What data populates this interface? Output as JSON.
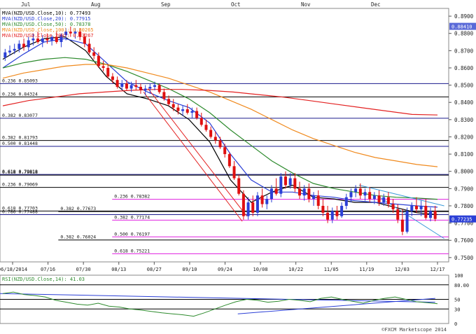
{
  "chart_data": [
    {
      "type": "candlestick",
      "title": "",
      "ylim": [
        0.7475,
        0.8945
      ],
      "months": [
        "Jul",
        "Aug",
        "Sep",
        "Oct",
        "Nov",
        "Dec"
      ],
      "date_ticks": [
        "06/18/2014",
        "07/16",
        "07/30",
        "08/13",
        "08/27",
        "09/10",
        "09/24",
        "10/08",
        "10/22",
        "11/05",
        "11/19",
        "12/03",
        "12/17"
      ],
      "price_ticks": [
        {
          "label": "0.8900",
          "v": 0.89
        },
        {
          "label": "0.8800",
          "v": 0.88
        },
        {
          "label": "0.8700",
          "v": 0.87
        },
        {
          "label": "0.8600",
          "v": 0.86
        },
        {
          "label": "0.8500",
          "v": 0.85
        },
        {
          "label": "0.8400",
          "v": 0.84
        },
        {
          "label": "0.8300",
          "v": 0.83
        },
        {
          "label": "0.8200",
          "v": 0.82
        },
        {
          "label": "0.8100",
          "v": 0.81
        },
        {
          "label": "0.8000",
          "v": 0.8
        },
        {
          "label": "0.7900",
          "v": 0.79
        },
        {
          "label": "0.7800",
          "v": 0.78
        },
        {
          "label": "0.7700",
          "v": 0.77
        },
        {
          "label": "0.7600",
          "v": 0.76
        },
        {
          "label": "0.7500",
          "v": 0.75
        }
      ],
      "legend": [
        {
          "text": "MVA(NZD/USD.Close,10): 0.77493",
          "color": "#000000"
        },
        {
          "text": "MVA(NZD/USD.Close,20): 0.77915",
          "color": "#2b3fd6"
        },
        {
          "text": "MVA(NZD/USD.Close,50): 0.78378",
          "color": "#2e8b2e"
        },
        {
          "text": "MVA(NZD/USD.Close,100): 0.80265",
          "color": "#f08a1e"
        },
        {
          "text": "MVA(NZD/USD.Close,200): 0.83267",
          "color": "#e32222"
        }
      ],
      "price_badges": [
        {
          "label": "0.88410",
          "v": 0.8841,
          "color": "#5a6ad8"
        },
        {
          "label": "0.77235",
          "v": 0.7724,
          "color": "#2b3fd6"
        }
      ],
      "fib_levels": [
        {
          "label": "0.236 0.85093",
          "v": 0.8509,
          "color": "#1a1a8c",
          "x_start": 0.0
        },
        {
          "label": "0.236 0.84324",
          "v": 0.8432,
          "color": "#000000",
          "x_start": 0.0
        },
        {
          "label": "0.382 0.83077",
          "v": 0.8308,
          "color": "#1a1a8c",
          "x_start": 0.0
        },
        {
          "label": "0.382 0.81793",
          "v": 0.8179,
          "color": "#000000",
          "x_start": 0.0
        },
        {
          "label": "0.500 0.81448",
          "v": 0.8145,
          "color": "#1a1a8c",
          "x_start": 0.0
        },
        {
          "label": "0.618 0.79818",
          "v": 0.7982,
          "color": "#1a1a8c",
          "x_start": 0.0
        },
        {
          "label": "0.618 0.79818",
          "v": 0.7978,
          "color": "#000000",
          "x_start": 0.0
        },
        {
          "label": "0.236 0.79069",
          "v": 0.7907,
          "color": "#000000",
          "x_start": 0.0
        },
        {
          "label": "0.236 0.78382",
          "v": 0.7838,
          "color": "#e020e0",
          "x_start": 0.25
        },
        {
          "label": "0.618 0.77703",
          "v": 0.777,
          "color": "#000000",
          "x_start": 0.0
        },
        {
          "label": "0.382 0.77673",
          "v": 0.7767,
          "color": "#000000",
          "x_start": 0.13
        },
        {
          "label": "0.786 0.77488",
          "v": 0.7749,
          "color": "#1a1a8c",
          "x_start": 0.0
        },
        {
          "label": "0.382 0.77174",
          "v": 0.7717,
          "color": "#e020e0",
          "x_start": 0.25
        },
        {
          "label": "0.500 0.76197",
          "v": 0.762,
          "color": "#e020e0",
          "x_start": 0.25
        },
        {
          "label": "0.382 0.76024",
          "v": 0.7602,
          "color": "#000000",
          "x_start": 0.13
        },
        {
          "label": "0.618 0.75221",
          "v": 0.7522,
          "color": "#e020e0",
          "x_start": 0.25
        }
      ],
      "candles": [
        {
          "o": 0.866,
          "h": 0.871,
          "l": 0.864,
          "c": 0.869
        },
        {
          "o": 0.869,
          "h": 0.873,
          "l": 0.867,
          "c": 0.87
        },
        {
          "o": 0.87,
          "h": 0.874,
          "l": 0.868,
          "c": 0.871
        },
        {
          "o": 0.871,
          "h": 0.876,
          "l": 0.869,
          "c": 0.874
        },
        {
          "o": 0.874,
          "h": 0.877,
          "l": 0.87,
          "c": 0.872
        },
        {
          "o": 0.872,
          "h": 0.878,
          "l": 0.87,
          "c": 0.876
        },
        {
          "o": 0.876,
          "h": 0.88,
          "l": 0.873,
          "c": 0.877
        },
        {
          "o": 0.877,
          "h": 0.881,
          "l": 0.874,
          "c": 0.875
        },
        {
          "o": 0.875,
          "h": 0.879,
          "l": 0.872,
          "c": 0.877
        },
        {
          "o": 0.877,
          "h": 0.88,
          "l": 0.874,
          "c": 0.876
        },
        {
          "o": 0.876,
          "h": 0.879,
          "l": 0.873,
          "c": 0.878
        },
        {
          "o": 0.878,
          "h": 0.881,
          "l": 0.874,
          "c": 0.875
        },
        {
          "o": 0.875,
          "h": 0.88,
          "l": 0.872,
          "c": 0.879
        },
        {
          "o": 0.879,
          "h": 0.883,
          "l": 0.876,
          "c": 0.881
        },
        {
          "o": 0.881,
          "h": 0.884,
          "l": 0.878,
          "c": 0.88
        },
        {
          "o": 0.88,
          "h": 0.883,
          "l": 0.877,
          "c": 0.881
        },
        {
          "o": 0.881,
          "h": 0.883,
          "l": 0.876,
          "c": 0.878
        },
        {
          "o": 0.878,
          "h": 0.88,
          "l": 0.872,
          "c": 0.874
        },
        {
          "o": 0.874,
          "h": 0.877,
          "l": 0.868,
          "c": 0.869
        },
        {
          "o": 0.869,
          "h": 0.872,
          "l": 0.865,
          "c": 0.867
        },
        {
          "o": 0.867,
          "h": 0.869,
          "l": 0.86,
          "c": 0.861
        },
        {
          "o": 0.861,
          "h": 0.864,
          "l": 0.858,
          "c": 0.86
        },
        {
          "o": 0.86,
          "h": 0.862,
          "l": 0.854,
          "c": 0.855
        },
        {
          "o": 0.855,
          "h": 0.857,
          "l": 0.851,
          "c": 0.853
        },
        {
          "o": 0.853,
          "h": 0.855,
          "l": 0.848,
          "c": 0.849
        },
        {
          "o": 0.849,
          "h": 0.853,
          "l": 0.847,
          "c": 0.851
        },
        {
          "o": 0.851,
          "h": 0.853,
          "l": 0.847,
          "c": 0.848
        },
        {
          "o": 0.848,
          "h": 0.852,
          "l": 0.846,
          "c": 0.85
        },
        {
          "o": 0.85,
          "h": 0.853,
          "l": 0.847,
          "c": 0.849
        },
        {
          "o": 0.849,
          "h": 0.851,
          "l": 0.845,
          "c": 0.847
        },
        {
          "o": 0.847,
          "h": 0.85,
          "l": 0.844,
          "c": 0.848
        },
        {
          "o": 0.848,
          "h": 0.851,
          "l": 0.845,
          "c": 0.849
        },
        {
          "o": 0.849,
          "h": 0.852,
          "l": 0.847,
          "c": 0.85
        },
        {
          "o": 0.85,
          "h": 0.851,
          "l": 0.845,
          "c": 0.846
        },
        {
          "o": 0.846,
          "h": 0.848,
          "l": 0.841,
          "c": 0.842
        },
        {
          "o": 0.842,
          "h": 0.844,
          "l": 0.838,
          "c": 0.839
        },
        {
          "o": 0.839,
          "h": 0.842,
          "l": 0.835,
          "c": 0.837
        },
        {
          "o": 0.837,
          "h": 0.839,
          "l": 0.833,
          "c": 0.835
        },
        {
          "o": 0.835,
          "h": 0.838,
          "l": 0.832,
          "c": 0.836
        },
        {
          "o": 0.836,
          "h": 0.839,
          "l": 0.833,
          "c": 0.834
        },
        {
          "o": 0.834,
          "h": 0.837,
          "l": 0.831,
          "c": 0.835
        },
        {
          "o": 0.835,
          "h": 0.837,
          "l": 0.83,
          "c": 0.831
        },
        {
          "o": 0.831,
          "h": 0.834,
          "l": 0.826,
          "c": 0.827
        },
        {
          "o": 0.827,
          "h": 0.83,
          "l": 0.823,
          "c": 0.824
        },
        {
          "o": 0.824,
          "h": 0.826,
          "l": 0.819,
          "c": 0.82
        },
        {
          "o": 0.82,
          "h": 0.823,
          "l": 0.816,
          "c": 0.818
        },
        {
          "o": 0.818,
          "h": 0.82,
          "l": 0.813,
          "c": 0.814
        },
        {
          "o": 0.814,
          "h": 0.816,
          "l": 0.808,
          "c": 0.81
        },
        {
          "o": 0.81,
          "h": 0.811,
          "l": 0.802,
          "c": 0.803
        },
        {
          "o": 0.803,
          "h": 0.806,
          "l": 0.795,
          "c": 0.796
        },
        {
          "o": 0.796,
          "h": 0.798,
          "l": 0.786,
          "c": 0.787
        },
        {
          "o": 0.787,
          "h": 0.789,
          "l": 0.772,
          "c": 0.774
        },
        {
          "o": 0.774,
          "h": 0.785,
          "l": 0.772,
          "c": 0.782
        },
        {
          "o": 0.782,
          "h": 0.786,
          "l": 0.774,
          "c": 0.776
        },
        {
          "o": 0.776,
          "h": 0.788,
          "l": 0.774,
          "c": 0.786
        },
        {
          "o": 0.786,
          "h": 0.79,
          "l": 0.779,
          "c": 0.781
        },
        {
          "o": 0.781,
          "h": 0.786,
          "l": 0.778,
          "c": 0.784
        },
        {
          "o": 0.784,
          "h": 0.792,
          "l": 0.782,
          "c": 0.79
        },
        {
          "o": 0.79,
          "h": 0.796,
          "l": 0.786,
          "c": 0.787
        },
        {
          "o": 0.787,
          "h": 0.799,
          "l": 0.785,
          "c": 0.797
        },
        {
          "o": 0.797,
          "h": 0.8,
          "l": 0.79,
          "c": 0.792
        },
        {
          "o": 0.792,
          "h": 0.799,
          "l": 0.79,
          "c": 0.796
        },
        {
          "o": 0.796,
          "h": 0.799,
          "l": 0.788,
          "c": 0.79
        },
        {
          "o": 0.79,
          "h": 0.794,
          "l": 0.784,
          "c": 0.786
        },
        {
          "o": 0.786,
          "h": 0.792,
          "l": 0.783,
          "c": 0.79
        },
        {
          "o": 0.79,
          "h": 0.793,
          "l": 0.782,
          "c": 0.784
        },
        {
          "o": 0.784,
          "h": 0.788,
          "l": 0.78,
          "c": 0.786
        },
        {
          "o": 0.786,
          "h": 0.789,
          "l": 0.778,
          "c": 0.78
        },
        {
          "o": 0.78,
          "h": 0.784,
          "l": 0.774,
          "c": 0.776
        },
        {
          "o": 0.776,
          "h": 0.78,
          "l": 0.77,
          "c": 0.772
        },
        {
          "o": 0.772,
          "h": 0.779,
          "l": 0.77,
          "c": 0.777
        },
        {
          "o": 0.777,
          "h": 0.78,
          "l": 0.772,
          "c": 0.774
        },
        {
          "o": 0.774,
          "h": 0.782,
          "l": 0.773,
          "c": 0.78
        },
        {
          "o": 0.78,
          "h": 0.787,
          "l": 0.778,
          "c": 0.785
        },
        {
          "o": 0.785,
          "h": 0.79,
          "l": 0.782,
          "c": 0.788
        },
        {
          "o": 0.788,
          "h": 0.792,
          "l": 0.785,
          "c": 0.79
        },
        {
          "o": 0.79,
          "h": 0.793,
          "l": 0.784,
          "c": 0.786
        },
        {
          "o": 0.786,
          "h": 0.79,
          "l": 0.783,
          "c": 0.788
        },
        {
          "o": 0.788,
          "h": 0.791,
          "l": 0.782,
          "c": 0.784
        },
        {
          "o": 0.784,
          "h": 0.788,
          "l": 0.781,
          "c": 0.786
        },
        {
          "o": 0.786,
          "h": 0.789,
          "l": 0.78,
          "c": 0.782
        },
        {
          "o": 0.782,
          "h": 0.787,
          "l": 0.78,
          "c": 0.785
        },
        {
          "o": 0.785,
          "h": 0.788,
          "l": 0.779,
          "c": 0.781
        },
        {
          "o": 0.781,
          "h": 0.784,
          "l": 0.776,
          "c": 0.778
        },
        {
          "o": 0.778,
          "h": 0.781,
          "l": 0.77,
          "c": 0.772
        },
        {
          "o": 0.772,
          "h": 0.778,
          "l": 0.763,
          "c": 0.765
        },
        {
          "o": 0.765,
          "h": 0.779,
          "l": 0.764,
          "c": 0.777
        },
        {
          "o": 0.777,
          "h": 0.782,
          "l": 0.774,
          "c": 0.78
        },
        {
          "o": 0.78,
          "h": 0.785,
          "l": 0.776,
          "c": 0.778
        },
        {
          "o": 0.778,
          "h": 0.783,
          "l": 0.774,
          "c": 0.78
        },
        {
          "o": 0.78,
          "h": 0.784,
          "l": 0.772,
          "c": 0.773
        },
        {
          "o": 0.773,
          "h": 0.779,
          "l": 0.771,
          "c": 0.777
        },
        {
          "o": 0.777,
          "h": 0.78,
          "l": 0.771,
          "c": 0.7724
        }
      ],
      "moving_averages": [
        {
          "period": 10,
          "color": "#000000",
          "points": [
            0.865,
            0.872,
            0.877,
            0.878,
            0.87,
            0.855,
            0.845,
            0.842,
            0.838,
            0.83,
            0.817,
            0.795,
            0.782,
            0.788,
            0.792,
            0.785,
            0.784,
            0.782,
            0.782,
            0.779,
            0.776,
            0.7749
          ]
        },
        {
          "period": 20,
          "color": "#2b3fd6",
          "points": [
            0.86,
            0.868,
            0.875,
            0.877,
            0.874,
            0.863,
            0.852,
            0.846,
            0.841,
            0.837,
            0.828,
            0.81,
            0.795,
            0.788,
            0.788,
            0.786,
            0.785,
            0.783,
            0.782,
            0.781,
            0.78,
            0.7792
          ]
        },
        {
          "period": 50,
          "color": "#2e8b2e",
          "points": [
            0.86,
            0.863,
            0.865,
            0.866,
            0.865,
            0.862,
            0.858,
            0.853,
            0.848,
            0.842,
            0.834,
            0.824,
            0.815,
            0.806,
            0.799,
            0.793,
            0.79,
            0.788,
            0.786,
            0.785,
            0.7845,
            0.7838
          ]
        },
        {
          "period": 100,
          "color": "#f08a1e",
          "points": [
            0.854,
            0.857,
            0.859,
            0.861,
            0.862,
            0.862,
            0.86,
            0.857,
            0.854,
            0.85,
            0.846,
            0.841,
            0.836,
            0.83,
            0.824,
            0.819,
            0.815,
            0.811,
            0.808,
            0.806,
            0.804,
            0.8027
          ]
        },
        {
          "period": 200,
          "color": "#e32222",
          "points": [
            0.838,
            0.841,
            0.843,
            0.845,
            0.846,
            0.847,
            0.8475,
            0.8475,
            0.847,
            0.846,
            0.8445,
            0.843,
            0.841,
            0.839,
            0.837,
            0.835,
            0.833,
            0.8327
          ]
        }
      ],
      "trendlines": [
        {
          "color": "#e32222",
          "from": [
            0.32,
            0.846
          ],
          "to": [
            0.54,
            0.771
          ]
        },
        {
          "color": "#e32222",
          "from": [
            0.33,
            0.848
          ],
          "to": [
            0.55,
            0.774
          ]
        },
        {
          "color": "#3a9ad8",
          "from": [
            0.8,
            0.792
          ],
          "to": [
            0.99,
            0.78
          ]
        },
        {
          "color": "#3a9ad8",
          "from": [
            0.84,
            0.786
          ],
          "to": [
            0.99,
            0.761
          ]
        }
      ]
    },
    {
      "type": "line",
      "title": "",
      "legend": [
        {
          "text": "RSI(NZD/USD.Close,14): 41.03",
          "color": "#2e8b2e"
        }
      ],
      "ylim": [
        0,
        100
      ],
      "tick_labels": [
        {
          "label": "100",
          "v": 100
        },
        {
          "label": "80.00",
          "v": 80
        },
        {
          "label": "50",
          "v": 50
        },
        {
          "label": "30",
          "v": 30
        },
        {
          "label": "0",
          "v": 0
        }
      ],
      "series": [
        {
          "color": "#2e8b2e",
          "values": [
            62,
            65,
            60,
            58,
            55,
            48,
            44,
            40,
            38,
            42,
            36,
            34,
            30,
            28,
            25,
            22,
            20,
            18,
            15,
            22,
            30,
            38,
            45,
            50,
            48,
            44,
            46,
            50,
            48,
            45,
            52,
            55,
            50,
            46,
            42,
            48,
            52,
            55,
            50,
            45,
            43,
            41
          ]
        }
      ],
      "trendlines": [
        {
          "color": "#2b3fd6",
          "from": [
            0.0,
            62
          ],
          "to": [
            0.97,
            44
          ]
        },
        {
          "color": "#2b3fd6",
          "from": [
            0.53,
            20
          ],
          "to": [
            0.97,
            52
          ]
        }
      ]
    }
  ],
  "watermark": "©FXCM Marketscope 2014"
}
